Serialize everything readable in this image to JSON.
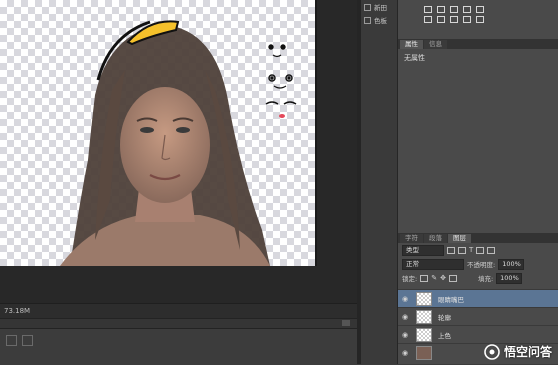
{
  "status": {
    "zoom_readout": "73.18M"
  },
  "narrow_column": {
    "items": [
      {
        "label": "新田",
        "icon": "swatches-icon"
      },
      {
        "label": "色板",
        "icon": "color-icon"
      }
    ]
  },
  "right_panel": {
    "properties_tabs": [
      "属性",
      "信息"
    ],
    "properties_content": "无属性",
    "layers_tabs": [
      "字符",
      "段落",
      "图层"
    ],
    "filter_kind": "类型",
    "blend_mode": "正常",
    "opacity_label": "不透明度:",
    "opacity_value": "100%",
    "lock_label": "锁定:",
    "fill_label": "填充:",
    "fill_value": "100%",
    "layers": [
      {
        "name": "眼睛嘴巴",
        "selected": true
      },
      {
        "name": "轮廓",
        "selected": false
      },
      {
        "name": "上色",
        "selected": false
      },
      {
        "name": "",
        "selected": false
      }
    ]
  },
  "watermark": {
    "text": "悟空问答"
  },
  "colors": {
    "selected_layer": "#5b7594",
    "panel_bg": "#4a4a4a",
    "hair_yellow": "#f5c12b"
  }
}
